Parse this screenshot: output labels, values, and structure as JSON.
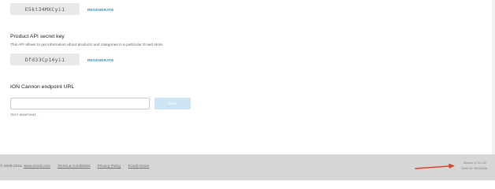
{
  "top_key": {
    "value": "E5kt34MXCyi1",
    "regenerate_label": "REGENERATE"
  },
  "product_api": {
    "title": "Product API secret key",
    "description": "This API allows to get information about products and categories in a particular Ecwid store.",
    "key_value": "Dfd33Cp14yi1",
    "regenerate_label": "REGENERATE"
  },
  "ion_cannon": {
    "title": "ION Cannon endpoint URL",
    "url_value": "",
    "url_placeholder": "",
    "save_label": "Save",
    "test_label": "TEST ENDPOINT..."
  },
  "footer": {
    "copyright_prefix": "© 2009-2015",
    "links": [
      "www.ecwid.com",
      "Terms & Conditions",
      "Privacy Policy",
      "Ecwid Home"
    ],
    "version": "Version 17.11.437",
    "store_id": "Store ID: 99013048"
  },
  "colors": {
    "link_blue": "#2d8cc8",
    "save_disabled": "#cde4f5",
    "footer_bg": "#d6d6d6",
    "arrow_red": "#d9452b"
  }
}
